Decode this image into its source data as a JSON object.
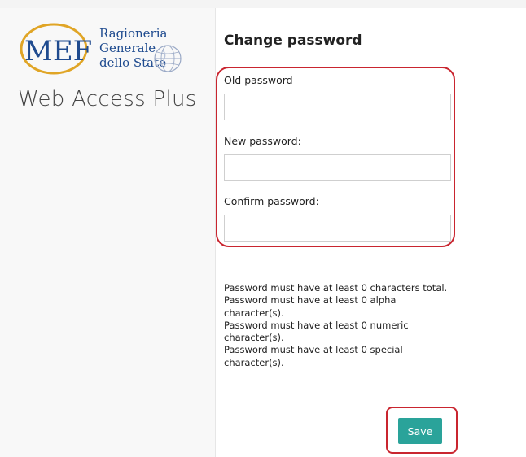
{
  "brand": {
    "logo_acronym": "MEF",
    "logo_lines": [
      "Ragioneria",
      "Generale",
      "dello Stato"
    ],
    "app_title": "Web Access Plus",
    "accent_color": "#1f4b8f",
    "logo_ring_color": "#e0a526"
  },
  "form": {
    "title": "Change password",
    "fields": [
      {
        "label": "Old password",
        "value": "",
        "placeholder": ""
      },
      {
        "label": "New password:",
        "value": "",
        "placeholder": ""
      },
      {
        "label": "Confirm password:",
        "value": "",
        "placeholder": ""
      }
    ],
    "rules": [
      "Password must have at least 0 characters total.",
      "Password must have at least 0 alpha character(s).",
      "Password must have at least 0 numeric character(s).",
      "Password must have at least 0 special character(s)."
    ],
    "save_label": "Save",
    "save_color": "#2aa39a",
    "highlight_color": "#c9252f"
  }
}
